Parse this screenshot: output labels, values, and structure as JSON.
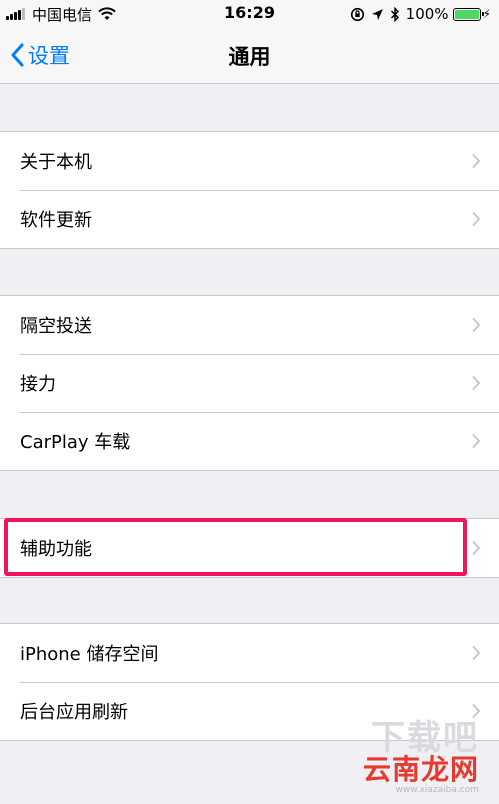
{
  "status_bar": {
    "carrier": "中国电信",
    "time": "16:29",
    "battery_percent": "100%",
    "battery_level": 1.0,
    "battery_color": "#4cd964"
  },
  "nav": {
    "back_label": "设置",
    "title": "通用",
    "accent_color": "#007aff"
  },
  "groups": [
    {
      "items": [
        {
          "label": "关于本机"
        },
        {
          "label": "软件更新"
        }
      ]
    },
    {
      "items": [
        {
          "label": "隔空投送"
        },
        {
          "label": "接力"
        },
        {
          "label": "CarPlay 车载"
        }
      ]
    },
    {
      "items": [
        {
          "label": "辅助功能",
          "highlighted": true
        }
      ]
    },
    {
      "items": [
        {
          "label": "iPhone 储存空间"
        },
        {
          "label": "后台应用刷新"
        }
      ]
    }
  ],
  "highlight_color": "#f0145a",
  "watermark": {
    "ghost_text": "下载吧",
    "brand": "云南龙网",
    "url": "www.xiazaiba.com"
  }
}
